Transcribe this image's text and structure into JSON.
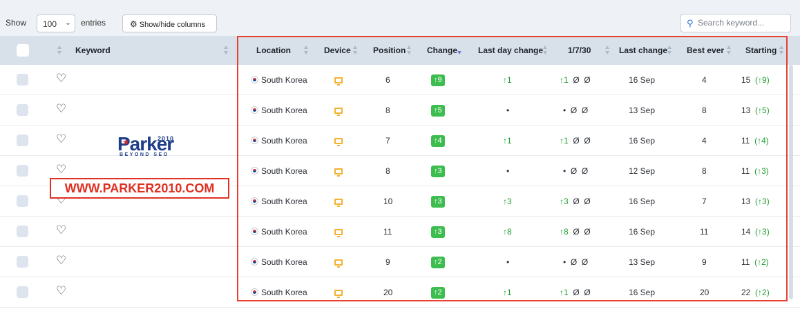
{
  "toolbar": {
    "show_label": "Show",
    "entries_value": "100",
    "entries_label": "entries",
    "columns_button_label": "Show/hide columns"
  },
  "search": {
    "placeholder": "Search keyword..."
  },
  "columns": {
    "keyword": "Keyword",
    "location": "Location",
    "device": "Device",
    "position": "Position",
    "change": "Change",
    "last_day_change": "Last day change",
    "period": "1/7/30",
    "last_change": "Last change",
    "best_ever": "Best ever",
    "starting": "Starting"
  },
  "logo": {
    "name": "Parker",
    "year": "2010",
    "tagline": "BEYOND SEO"
  },
  "watermark": "WWW.PARKER2010.COM",
  "colors": {
    "accent": "#2a71d0",
    "badge_green": "#3dbd4f",
    "up_green": "#1e9e2e",
    "highlight_red": "#e8402f"
  },
  "rows": [
    {
      "location": "South Korea",
      "position": "6",
      "change": "9",
      "last_day": "↑1",
      "p1": "↑1",
      "p7": "Ø",
      "p30": "Ø",
      "last_change": "16 Sep",
      "best": "4",
      "start": "15",
      "start_delta": "(↑9)"
    },
    {
      "location": "South Korea",
      "position": "8",
      "change": "5",
      "last_day": "•",
      "p1": "•",
      "p7": "Ø",
      "p30": "Ø",
      "last_change": "13 Sep",
      "best": "8",
      "start": "13",
      "start_delta": "(↑5)"
    },
    {
      "location": "South Korea",
      "position": "7",
      "change": "4",
      "last_day": "↑1",
      "p1": "↑1",
      "p7": "Ø",
      "p30": "Ø",
      "last_change": "16 Sep",
      "best": "4",
      "start": "11",
      "start_delta": "(↑4)"
    },
    {
      "location": "South Korea",
      "position": "8",
      "change": "3",
      "last_day": "•",
      "p1": "•",
      "p7": "Ø",
      "p30": "Ø",
      "last_change": "12 Sep",
      "best": "8",
      "start": "11",
      "start_delta": "(↑3)"
    },
    {
      "location": "South Korea",
      "position": "10",
      "change": "3",
      "last_day": "↑3",
      "p1": "↑3",
      "p7": "Ø",
      "p30": "Ø",
      "last_change": "16 Sep",
      "best": "7",
      "start": "13",
      "start_delta": "(↑3)"
    },
    {
      "location": "South Korea",
      "position": "11",
      "change": "3",
      "last_day": "↑8",
      "p1": "↑8",
      "p7": "Ø",
      "p30": "Ø",
      "last_change": "16 Sep",
      "best": "11",
      "start": "14",
      "start_delta": "(↑3)"
    },
    {
      "location": "South Korea",
      "position": "9",
      "change": "2",
      "last_day": "•",
      "p1": "•",
      "p7": "Ø",
      "p30": "Ø",
      "last_change": "13 Sep",
      "best": "9",
      "start": "11",
      "start_delta": "(↑2)"
    },
    {
      "location": "South Korea",
      "position": "20",
      "change": "2",
      "last_day": "↑1",
      "p1": "↑1",
      "p7": "Ø",
      "p30": "Ø",
      "last_change": "16 Sep",
      "best": "20",
      "start": "22",
      "start_delta": "(↑2)"
    }
  ]
}
